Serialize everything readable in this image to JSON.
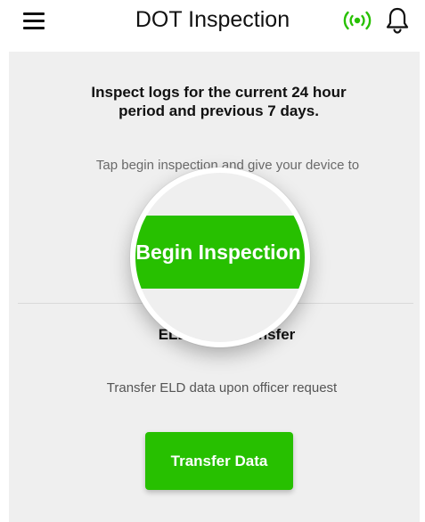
{
  "header": {
    "title": "DOT Inspection",
    "menu_icon": "hamburger-icon",
    "signal_icon": "signal-broadcast-icon",
    "notification_icon": "bell-icon",
    "accent_color": "#27c000"
  },
  "inspection": {
    "heading_line1": "Inspect logs for the current 24 hour",
    "heading_line2": "period and previous 7 days.",
    "description_visible": "Tap begin inspection and give your device to",
    "begin_button_label": "Begin Inspection"
  },
  "eld_transfer": {
    "title_visible_left": "ELD",
    "title_visible_right": "nsfer",
    "description": "Transfer ELD data upon officer request",
    "transfer_button_label": "Transfer Data"
  },
  "colors": {
    "button_green": "#27c000",
    "content_background": "#efefef"
  }
}
